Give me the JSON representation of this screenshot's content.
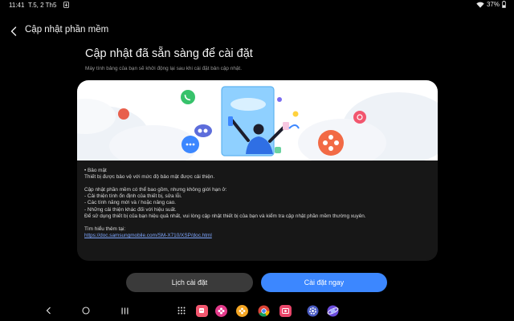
{
  "status_bar": {
    "time": "11:41",
    "date": "T.5, 2 Th5",
    "battery_percent": "37%",
    "icons": [
      "download-icon",
      "wifi-icon",
      "battery-icon"
    ]
  },
  "header": {
    "title": "Cập nhật phần mềm",
    "back_icon": "chevron-left-icon"
  },
  "main": {
    "title": "Cập nhật đã sẵn sàng để cài đặt",
    "subtitle": "Máy tính bảng của bạn sẽ khởi động lại sau khi cài đặt bản cập nhật."
  },
  "details": {
    "security_heading": "• Bảo mật",
    "security_text": "Thiết bị được bảo vệ với mức độ bảo mật được cải thiện.",
    "intro": "Cập nhật phần mềm có thể bao gồm, nhưng không giới hạn ở:",
    "item_1": " - Cải thiện tính ổn định của thiết bị, sửa lỗi.",
    "item_2": " - Các tính năng mới và / hoặc nâng cao.",
    "item_3": " - Những cải thiện khác đối với hiệu suất.",
    "advice": "Để sử dụng thiết bị của bạn hiệu quả nhất, vui lòng cập nhật thiết bị của bạn và kiểm tra cập nhật phần mềm thường xuyên.",
    "learn_more": "Tìm hiểu thêm tại:",
    "link": "https://doc.samsungmobile.com/SM-X710/XSP/doc.html"
  },
  "buttons": {
    "schedule": "Lịch cài đặt",
    "install_now": "Cài đặt ngay"
  },
  "colors": {
    "background": "#000000",
    "card": "#171717",
    "accent_button": "#3c87ff",
    "secondary_button": "#3a3a3a",
    "link": "#7fa7ff"
  },
  "nav_bar": {
    "buttons": [
      "back-nav-icon",
      "home-nav-icon",
      "recents-nav-icon"
    ],
    "dock_apps": [
      "apps-grid-icon",
      "samsung-notes-icon",
      "gallery-icon",
      "bixby-icon",
      "chrome-icon",
      "screen-recorder-icon",
      "settings-icon",
      "samsung-internet-icon"
    ]
  }
}
